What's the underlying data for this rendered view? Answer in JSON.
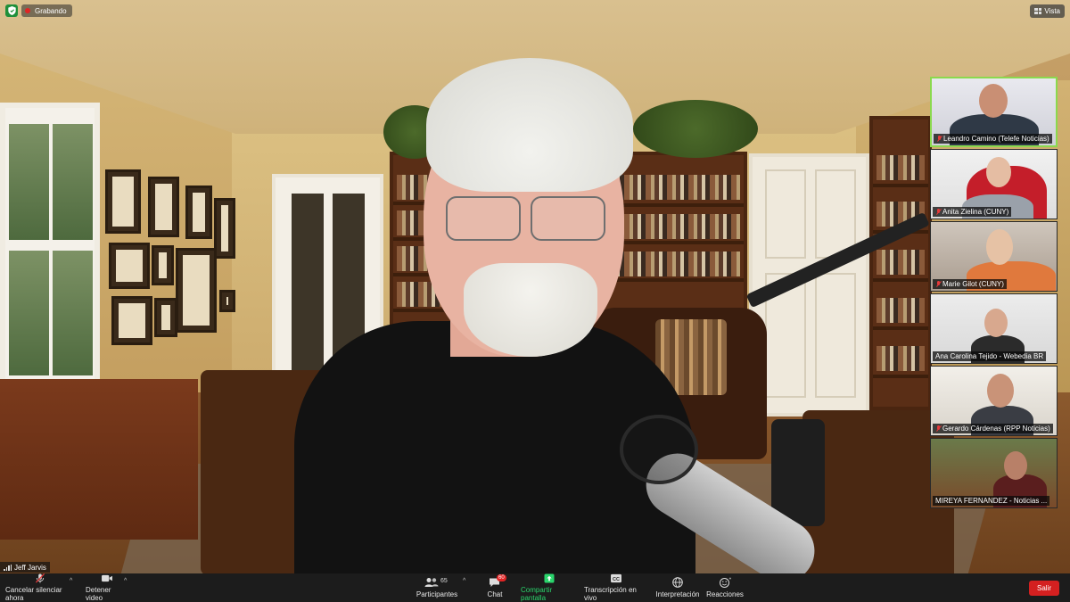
{
  "top": {
    "recording_label": "Grabando",
    "view_label": "Vista"
  },
  "speaker": {
    "name": "Jeff Jarvis"
  },
  "participants": [
    {
      "name": "Leandro Camino (Telefe Noticias)",
      "muted": true,
      "active": true
    },
    {
      "name": "Anita Zielina (CUNY)",
      "muted": true,
      "active": false
    },
    {
      "name": "Marie Gilot (CUNY)",
      "muted": true,
      "active": false
    },
    {
      "name": "Ana Carolina Tejido - Webedia BR",
      "muted": false,
      "active": false
    },
    {
      "name": "Gerardo Cárdenas (RPP Noticias)",
      "muted": true,
      "active": false
    },
    {
      "name": "MIREYA FERNANDEZ - Noticias ...",
      "muted": false,
      "active": false
    }
  ],
  "toolbar": {
    "unmute_label": "Cancelar silenciar ahora",
    "stop_video_label": "Detener video",
    "participants_label": "Participantes",
    "participants_count": "65",
    "chat_label": "Chat",
    "chat_badge": "60",
    "share_label": "Compartir pantalla",
    "transcription_label": "Transcripción en vivo",
    "interpretation_label": "Interpretación",
    "reactions_label": "Reacciones",
    "leave_label": "Salir",
    "share_color": "#2ad56c",
    "leave_color": "#d42020"
  }
}
